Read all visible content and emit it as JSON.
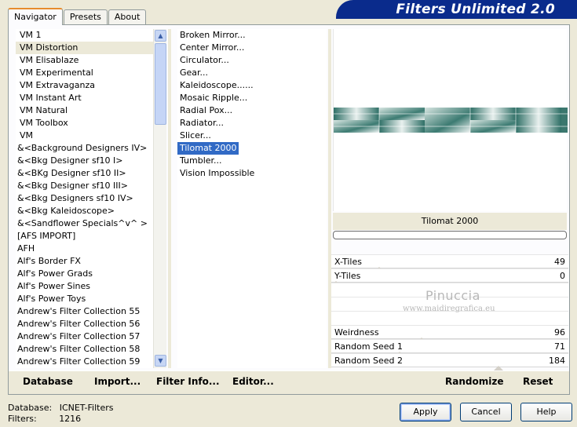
{
  "tabs": [
    {
      "label": "Navigator",
      "active": true
    },
    {
      "label": "Presets",
      "active": false
    },
    {
      "label": "About",
      "active": false
    }
  ],
  "banner": {
    "title": "Filters Unlimited 2.0"
  },
  "categories": [
    "VM 1",
    "VM Distortion",
    "VM Elisablaze",
    "VM Experimental",
    "VM Extravaganza",
    "VM Instant Art",
    "VM Natural",
    "VM Toolbox",
    "VM",
    "&<Background Designers IV>",
    "&<Bkg Designer sf10 I>",
    "&<BKg Designer sf10 II>",
    "&<Bkg Designer sf10 III>",
    "&<Bkg Designers sf10 IV>",
    "&<Bkg Kaleidoscope>",
    "&<Sandflower Specials^v^ >",
    "[AFS IMPORT]",
    "AFH",
    "Alf's Border FX",
    "Alf's Power Grads",
    "Alf's Power Sines",
    "Alf's Power Toys",
    "Andrew's Filter Collection 55",
    "Andrew's Filter Collection 56",
    "Andrew's Filter Collection 57",
    "Andrew's Filter Collection 58",
    "Andrew's Filter Collection 59"
  ],
  "selected_category": "VM Distortion",
  "filters": [
    "Broken Mirror...",
    "Center Mirror...",
    "Circulator...",
    "Gear...",
    "Kaleidoscope......",
    "Mosaic Ripple...",
    "Radial Pox...",
    "Radiator...",
    "Slicer...",
    "Tilomat 2000",
    "Tumbler...",
    "Vision Impossible"
  ],
  "selected_filter": "Tilomat 2000",
  "preview": {
    "filter_name": "Tilomat 2000",
    "progress": 0
  },
  "params": [
    {
      "label": "X-Tiles",
      "value": "49",
      "fraction": 0.19
    },
    {
      "label": "Y-Tiles",
      "value": "0",
      "fraction": 0.0
    },
    {
      "label": "Weirdness",
      "value": "96",
      "fraction": 0.38
    },
    {
      "label": "Random Seed 1",
      "value": "71",
      "fraction": 0.28
    },
    {
      "label": "Random Seed 2",
      "value": "184",
      "fraction": 0.72
    }
  ],
  "watermark": {
    "line1": "Pinuccia",
    "line2": "www.maidiregrafica.eu"
  },
  "actions": {
    "database": "Database",
    "import": "Import...",
    "filter_info": "Filter Info...",
    "editor": "Editor...",
    "randomize": "Randomize",
    "reset": "Reset"
  },
  "status": {
    "database_label": "Database:",
    "database_value": "ICNET-Filters",
    "filters_label": "Filters:",
    "filters_value": "1216"
  },
  "buttons": {
    "apply": "Apply",
    "cancel": "Cancel",
    "help": "Help"
  },
  "colors": {
    "banner": "#0a2b8c",
    "selection": "#316ac5",
    "preview_teal": "#2e6f66"
  }
}
